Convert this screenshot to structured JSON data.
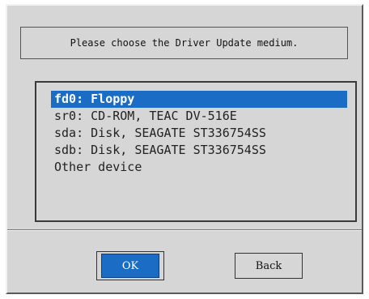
{
  "dialog": {
    "prompt": "Please choose the Driver Update medium.",
    "devices": [
      {
        "label": "fd0: Floppy",
        "selected": true
      },
      {
        "label": "sr0: CD-ROM, TEAC DV-516E",
        "selected": false
      },
      {
        "label": "sda: Disk, SEAGATE ST336754SS",
        "selected": false
      },
      {
        "label": "sdb: Disk, SEAGATE ST336754SS",
        "selected": false
      },
      {
        "label": "Other device",
        "selected": false
      }
    ],
    "buttons": {
      "ok_label": "OK",
      "back_label": "Back"
    }
  },
  "colors": {
    "dialog_background": "#d6d6d6",
    "selection": "#1b6cc4",
    "selection_text": "#ffffff"
  }
}
